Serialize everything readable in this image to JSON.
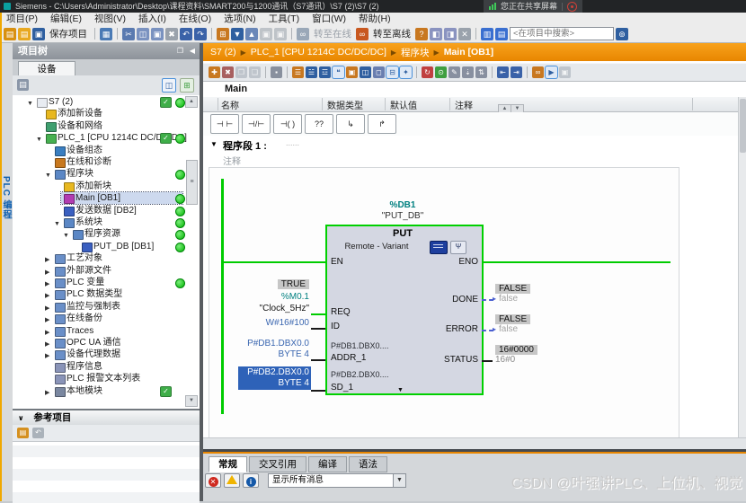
{
  "title_bar": {
    "app_title": "Siemens - C:\\Users\\Administrator\\Desktop\\课程资料\\SMART200与1200通讯（S7通讯）\\S7 (2)\\S7 (2)",
    "share_banner": "您正在共享屏幕"
  },
  "menu_bar": [
    {
      "id": "project",
      "label": "项目(P)"
    },
    {
      "id": "edit",
      "label": "编辑(E)"
    },
    {
      "id": "view",
      "label": "视图(V)"
    },
    {
      "id": "insert",
      "label": "插入(I)"
    },
    {
      "id": "online",
      "label": "在线(O)"
    },
    {
      "id": "options",
      "label": "选项(N)"
    },
    {
      "id": "tools",
      "label": "工具(T)"
    },
    {
      "id": "window",
      "label": "窗口(W)"
    },
    {
      "id": "help",
      "label": "帮助(H)"
    }
  ],
  "main_toolbar": {
    "search_placeholder": "<在项目中搜索>",
    "icons": [
      {
        "name": "new-project-icon",
        "glyph": "▤",
        "color": "#d89010"
      },
      {
        "name": "open-project-icon",
        "glyph": "▤",
        "color": "#e8a820"
      },
      {
        "name": "save-project-icon",
        "glyph": "▣",
        "color": "#2f5fa0",
        "label": "保存项目"
      },
      {
        "sep": true
      },
      {
        "name": "print-icon",
        "glyph": "▦",
        "color": "#4a7ab5"
      },
      {
        "sep": true
      },
      {
        "name": "cut-icon",
        "glyph": "✂",
        "color": "#5a7ab0"
      },
      {
        "name": "copy-icon",
        "glyph": "◫",
        "color": "#7a92c0"
      },
      {
        "name": "paste-icon",
        "glyph": "▣",
        "color": "#7a92c0"
      },
      {
        "name": "delete-icon",
        "glyph": "✖",
        "color": "#9aa2ac"
      },
      {
        "name": "undo-icon",
        "glyph": "↶",
        "color": "#3a62a8"
      },
      {
        "name": "redo-icon",
        "glyph": "↷",
        "color": "#3a62a8"
      },
      {
        "sep": true
      },
      {
        "name": "accessible-devices-icon",
        "glyph": "⊞",
        "color": "#c87820"
      },
      {
        "name": "download-to-device-icon",
        "glyph": "▼",
        "color": "#2f5fa0"
      },
      {
        "name": "upload-from-device-icon",
        "glyph": "▲",
        "color": "#6a87b8"
      },
      {
        "name": "start-cpu-icon",
        "glyph": "▣",
        "color": "#9aa2ac",
        "gray": true
      },
      {
        "name": "stop-cpu-icon",
        "glyph": "▣",
        "color": "#9aa2ac",
        "gray": true
      },
      {
        "sep": true
      },
      {
        "name": "go-online-icon",
        "glyph": "∞",
        "color": "#9aa8b8",
        "label": "转至在线",
        "label_gray": true
      },
      {
        "name": "go-offline-icon",
        "glyph": "∞",
        "color": "#c85820",
        "label": "转至离线"
      },
      {
        "name": "online-diagnostics-icon",
        "glyph": "?",
        "color": "#c87820"
      },
      {
        "name": "show-window1-icon",
        "glyph": "◧",
        "color": "#8a93c0"
      },
      {
        "name": "show-window2-icon",
        "glyph": "◨",
        "color": "#8a93c0"
      },
      {
        "name": "close-window-icon",
        "glyph": "✕",
        "color": "#9aa2ac"
      },
      {
        "sep": true
      },
      {
        "name": "split-horizontal-icon",
        "glyph": "▥",
        "color": "#3a6fd0"
      },
      {
        "name": "split-vertical-icon",
        "glyph": "▤",
        "color": "#3a6fd0"
      },
      {
        "search": true
      },
      {
        "name": "find-in-project-icon",
        "glyph": "⊚",
        "color": "#2f5fa0"
      }
    ]
  },
  "project_tree": {
    "title": "项目树",
    "tab_label": "设备",
    "items": [
      {
        "id": "s7-project",
        "label": "S7 (2)",
        "level": 0,
        "exp": "open",
        "icon": "project-icon",
        "color": "#e8ecf2",
        "check": true,
        "dot": true
      },
      {
        "id": "add-new-device",
        "label": "添加新设备",
        "level": 1,
        "exp": "",
        "icon": "add-device-icon",
        "color": "#e8b820"
      },
      {
        "id": "devices-networks",
        "label": "设备和网络",
        "level": 1,
        "exp": "",
        "icon": "devices-networks-icon",
        "color": "#3f9f6f"
      },
      {
        "id": "plc-1",
        "label": "PLC_1 [CPU 1214C DC/DC/DC]",
        "level": 1,
        "exp": "open",
        "icon": "plc-icon",
        "color": "#46b050",
        "check": true,
        "dot": true
      },
      {
        "id": "device-configuration",
        "label": "设备组态",
        "level": 2,
        "exp": "",
        "icon": "device-config-icon",
        "color": "#3a7ec0"
      },
      {
        "id": "online-diagnostics",
        "label": "在线和诊断",
        "level": 2,
        "exp": "",
        "icon": "diagnostics-icon",
        "color": "#c8781e"
      },
      {
        "id": "program-blocks",
        "label": "程序块",
        "level": 2,
        "exp": "open",
        "icon": "program-blocks-folder-icon",
        "color": "#5b87c5",
        "dot": true
      },
      {
        "id": "add-new-block",
        "label": "添加新块",
        "level": 3,
        "exp": "",
        "icon": "add-block-icon",
        "color": "#e8b820"
      },
      {
        "id": "main-ob1",
        "label": "Main [OB1]",
        "level": 3,
        "exp": "",
        "icon": "ob-block-icon",
        "color": "#b23cb2",
        "dot": true,
        "selected": true
      },
      {
        "id": "send-data-db2",
        "label": "发送数据 [DB2]",
        "level": 3,
        "exp": "",
        "icon": "db-block-icon",
        "color": "#3a5fc0",
        "dot": true
      },
      {
        "id": "system-blocks",
        "label": "系统块",
        "level": 3,
        "exp": "open",
        "icon": "system-blocks-folder-icon",
        "color": "#5b87c5",
        "dot": true
      },
      {
        "id": "program-resources",
        "label": "程序资源",
        "level": 4,
        "exp": "open",
        "icon": "program-resources-folder-icon",
        "color": "#5b87c5",
        "dot": true
      },
      {
        "id": "put-db-db1",
        "label": "PUT_DB [DB1]",
        "level": 5,
        "exp": "",
        "icon": "db-block-icon",
        "color": "#3a5fc0",
        "dot": true
      },
      {
        "id": "technology-objects",
        "label": "工艺对象",
        "level": 2,
        "exp": "closed",
        "icon": "technology-objects-folder-icon",
        "color": "#6a8fc8"
      },
      {
        "id": "external-sources",
        "label": "外部源文件",
        "level": 2,
        "exp": "closed",
        "icon": "external-sources-folder-icon",
        "color": "#6a8fc8"
      },
      {
        "id": "plc-tags",
        "label": "PLC 变量",
        "level": 2,
        "exp": "closed",
        "icon": "plc-tags-folder-icon",
        "color": "#6a8fc8",
        "dot": true
      },
      {
        "id": "plc-data-types",
        "label": "PLC 数据类型",
        "level": 2,
        "exp": "closed",
        "icon": "plc-data-types-folder-icon",
        "color": "#6a8fc8"
      },
      {
        "id": "watch-force-tables",
        "label": "监控与强制表",
        "level": 2,
        "exp": "closed",
        "icon": "watch-tables-folder-icon",
        "color": "#6a8fc8"
      },
      {
        "id": "online-backups",
        "label": "在线备份",
        "level": 2,
        "exp": "closed",
        "icon": "online-backups-folder-icon",
        "color": "#6a8fc8"
      },
      {
        "id": "traces",
        "label": "Traces",
        "level": 2,
        "exp": "closed",
        "icon": "traces-folder-icon",
        "color": "#6a8fc8"
      },
      {
        "id": "opc-ua",
        "label": "OPC UA 通信",
        "level": 2,
        "exp": "closed",
        "icon": "opc-ua-folder-icon",
        "color": "#6a8fc8"
      },
      {
        "id": "device-proxy-data",
        "label": "设备代理数据",
        "level": 2,
        "exp": "closed",
        "icon": "device-proxy-folder-icon",
        "color": "#6a8fc8"
      },
      {
        "id": "program-info",
        "label": "程序信息",
        "level": 2,
        "exp": "",
        "icon": "program-info-icon",
        "color": "#8a94b8"
      },
      {
        "id": "plc-alarm-text-lists",
        "label": "PLC 报警文本列表",
        "level": 2,
        "exp": "",
        "icon": "alarm-text-list-icon",
        "color": "#8a94b8"
      },
      {
        "id": "local-modules",
        "label": "本地模块",
        "level": 2,
        "exp": "closed",
        "icon": "local-modules-folder-icon",
        "color": "#7a87a0",
        "check": true
      }
    ]
  },
  "reference_panel": {
    "title": "参考项目"
  },
  "editor": {
    "breadcrumb": [
      "S7 (2)",
      "PLC_1 [CPU 1214C DC/DC/DC]",
      "程序块",
      "Main [OB1]"
    ],
    "toolbar_icons": [
      {
        "name": "insert-network-icon",
        "glyph": "✚",
        "color": "#c87820"
      },
      {
        "name": "delete-network-icon",
        "glyph": "✖",
        "color": "#a86060"
      },
      {
        "name": "copy-network-icon",
        "glyph": "❐",
        "color": "#9aa3ad",
        "gray": true
      },
      {
        "name": "paste-network-icon",
        "glyph": "❑",
        "color": "#9aa3ad",
        "gray": true
      },
      {
        "sep": true
      },
      {
        "name": "keep-actual-values-icon",
        "glyph": "▪",
        "color": "#88909e"
      },
      {
        "sep": true
      },
      {
        "name": "open-all-networks-icon",
        "glyph": "☰",
        "color": "#c87820"
      },
      {
        "name": "close-all-networks-icon",
        "glyph": "☱",
        "color": "#2f5fa0"
      },
      {
        "name": "absolute-symbolic-icon",
        "glyph": "☲",
        "color": "#2f5fa0"
      },
      {
        "name": "show-comments-icon",
        "glyph": "❝",
        "color": "#2f5fa0",
        "active": true
      },
      {
        "name": "favorites-icon",
        "glyph": "▣",
        "color": "#c87820"
      },
      {
        "name": "insert-box-icon",
        "glyph": "◫",
        "color": "#2f5fa0"
      },
      {
        "name": "insert-operand-icon",
        "glyph": "◻",
        "color": "#6a7fb0"
      },
      {
        "name": "expand-boxes-icon",
        "glyph": "⊟",
        "color": "#2f5fa0",
        "active": true
      },
      {
        "name": "wizard-icon",
        "glyph": "✦",
        "color": "#c87820",
        "active": true
      },
      {
        "sep": true
      },
      {
        "name": "update-block-calls-icon",
        "glyph": "↻",
        "color": "#c04040"
      },
      {
        "name": "go-monitor-icon",
        "glyph": "⊙",
        "color": "#3f9f40"
      },
      {
        "name": "snapshot-icon",
        "glyph": "✎",
        "color": "#8890a0"
      },
      {
        "name": "load-values-icon",
        "glyph": "⇣",
        "color": "#8890a0"
      },
      {
        "name": "compare-values-icon",
        "glyph": "⇅",
        "color": "#8890a0"
      },
      {
        "sep": true
      },
      {
        "name": "jump-previous-icon",
        "glyph": "⇤",
        "color": "#3a62a8"
      },
      {
        "name": "jump-next-icon",
        "glyph": "⇥",
        "color": "#3a62a8"
      },
      {
        "sep": true
      },
      {
        "name": "monitoring-glasses-icon",
        "glyph": "∞",
        "color": "#c87820"
      },
      {
        "name": "monitoring-toggle-icon",
        "glyph": "▶",
        "color": "#3f9f40",
        "active": true
      },
      {
        "name": "disabled-db-icon",
        "glyph": "▣",
        "color": "#9aa3ad",
        "gray": true
      }
    ],
    "block_tab": "Main",
    "table_columns": [
      "名称",
      "数据类型",
      "默认值",
      "注释"
    ],
    "lad_buttons": [
      {
        "name": "no-contact-button",
        "glyph": "⊣ ⊢"
      },
      {
        "name": "nc-contact-button",
        "glyph": "⊣/⊢"
      },
      {
        "name": "coil-button",
        "glyph": "⊣( )"
      },
      {
        "name": "empty-box-button",
        "glyph": "??"
      },
      {
        "name": "open-branch-button",
        "glyph": "↳"
      },
      {
        "name": "close-branch-button",
        "glyph": "↱"
      }
    ],
    "network": {
      "header": "程序段 1 :",
      "header_dots": "......",
      "comment_placeholder": "注释",
      "db_address": "%DB1",
      "db_name": "\"PUT_DB\"",
      "block_name": "PUT",
      "block_subtitle": "Remote - Variant",
      "pins": {
        "en": "EN",
        "eno": "ENO",
        "req": "REQ",
        "id": "ID",
        "addr1": "ADDR_1",
        "sd1": "SD_1",
        "done": "DONE",
        "error": "ERROR",
        "status": "STATUS"
      },
      "inline_addr1": "P#DB1.DBX0....",
      "inline_sd1": "P#DB2.DBX0....",
      "operands": {
        "req_monitor": "TRUE",
        "req_address": "%M0.1",
        "req_name": "\"Clock_5Hz\"",
        "id_value": "W#16#100",
        "addr1_line1": "P#DB1.DBX0.0",
        "addr1_line2": "BYTE 4",
        "sd1_line1": "P#DB2.DBX0.0",
        "sd1_line2": "BYTE 4",
        "done_monitor": "FALSE",
        "done_operand": "false",
        "error_monitor": "FALSE",
        "error_operand": "false",
        "status_monitor": "16#0000",
        "status_operand": "16#0"
      }
    },
    "bottom_tabs": [
      {
        "id": "general",
        "label": "常规",
        "active": true
      },
      {
        "id": "cross-reference",
        "label": "交叉引用"
      },
      {
        "id": "compile",
        "label": "编译"
      },
      {
        "id": "syntax",
        "label": "语法"
      }
    ],
    "message_filter": "显示所有消息"
  },
  "watermark": "CSDN @叶强讲PLC、上位机、视觉",
  "colors": {
    "accent_orange": "#e88600",
    "online_green": "#00cc00",
    "selection_blue": "#2e62b8"
  }
}
